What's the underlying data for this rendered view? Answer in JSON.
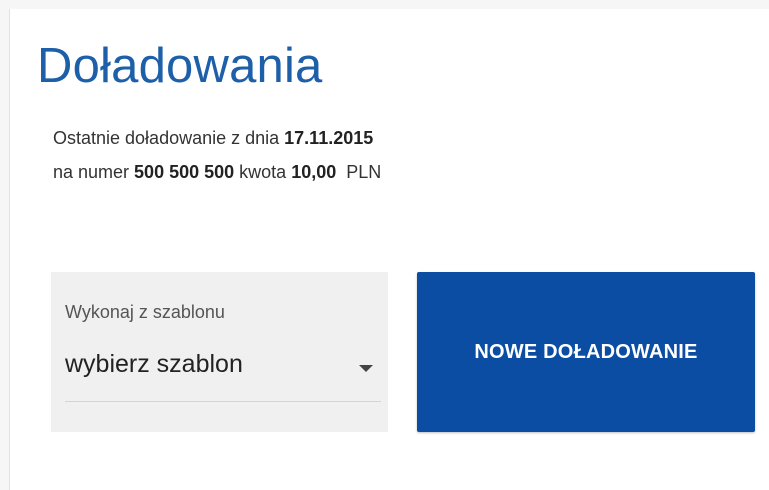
{
  "page": {
    "title": "Doładowania"
  },
  "last_topup": {
    "line1_prefix": "Ostatnie doładowanie z dnia ",
    "date": "17.11.2015",
    "line2_prefix": "na numer ",
    "number": "500 500 500",
    "amount_prefix": " kwota ",
    "amount": "10,00",
    "currency": "PLN"
  },
  "template": {
    "label": "Wykonaj z szablonu",
    "selected": "wybierz szablon",
    "icon": "caret-down-icon"
  },
  "actions": {
    "new_topup_label": "NOWE DOŁADOWANIE"
  },
  "colors": {
    "title": "#1d5fa8",
    "button_bg": "#0b4da2",
    "template_bg": "#f0f0f0"
  }
}
